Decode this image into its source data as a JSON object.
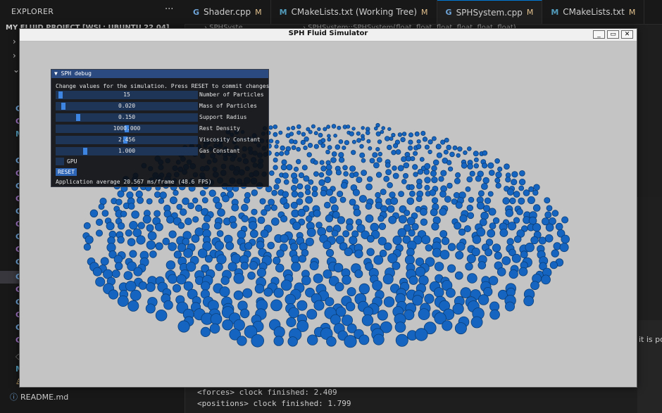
{
  "vscode": {
    "explorer_title": "EXPLORER",
    "more_label": "···",
    "project_label": "MY FLUID PROJECT [WSL: UBUNTU 22.04]",
    "readme_label": "README.md",
    "breadcrumb_left": "› SPHSyste",
    "breadcrumb_right": "› SPHSystem::SPHSystem(float, float, float, float, float, float)",
    "partial_text": "it is pow",
    "tabs": [
      {
        "icon": "G",
        "label": "Shader.cpp",
        "mod": "M"
      },
      {
        "icon": "M",
        "label": "CMakeLists.txt (Working Tree)",
        "mod": "M"
      },
      {
        "icon": "G",
        "label": "SPHSystem.cpp",
        "mod": "M"
      },
      {
        "icon": "M",
        "label": "CMakeLists.txt",
        "mod": "M"
      }
    ],
    "terminal": {
      "line1": "<forces> clock finished: 2.409",
      "line2": "<positions> clock finished: 1.799"
    }
  },
  "window": {
    "title": "SPH Fluid Simulator",
    "min_label": "_",
    "max_label": "▭",
    "close_label": "✕"
  },
  "debug": {
    "header": "▼ SPH debug",
    "instructions": "Change values for the simulation. Press RESET to commit changes",
    "sliders": [
      {
        "label": "Number of Particles",
        "value": "15",
        "level": 0.02
      },
      {
        "label": "Mass of Particles",
        "value": "0.020",
        "level": 0.04
      },
      {
        "label": "Support Radius",
        "value": "0.150",
        "level": 0.15
      },
      {
        "label": "Rest Density",
        "value": "1000.000",
        "level": 0.5
      },
      {
        "label": "Viscosity Constant",
        "value": "2.456",
        "level": 0.49
      },
      {
        "label": "Gas Constant",
        "value": "1.000",
        "level": 0.2
      }
    ],
    "gpu_label": "GPU",
    "reset_label": "RESET",
    "fps_text": "Application average 20.567 ms/frame (48.6 FPS)"
  },
  "colors": {
    "particle": "#1565c0",
    "particle_dark": "#0b3f7a",
    "viewport_bg": "#c4c4c4"
  }
}
